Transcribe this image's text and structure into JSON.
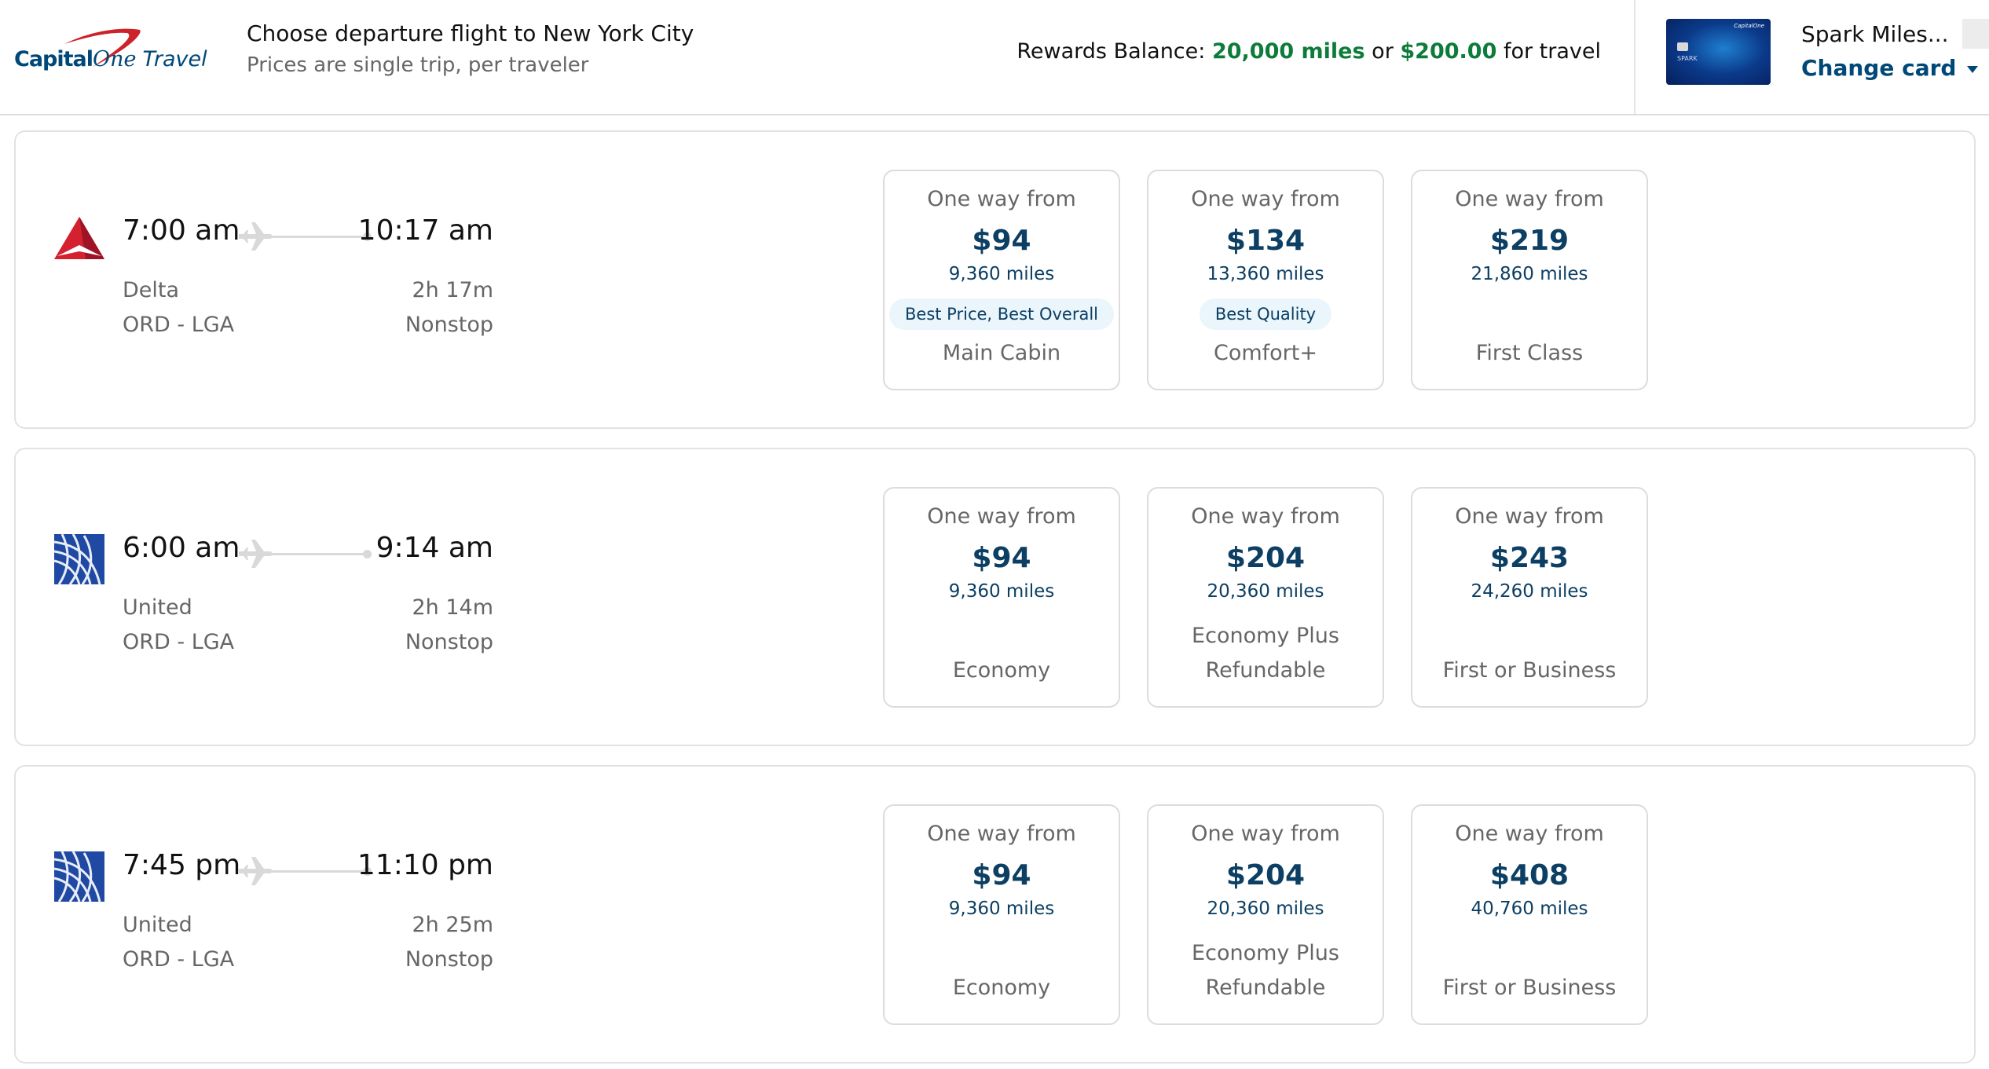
{
  "header": {
    "brand": {
      "name_bold": "Capital",
      "name_script": "One",
      "name_suffix": "Travel"
    },
    "title": "Choose departure flight to New York City",
    "subtitle": "Prices are single trip, per traveler",
    "rewards": {
      "label": "Rewards Balance:",
      "miles": "20,000 miles",
      "connector": "or",
      "cash": "$200.00",
      "suffix": "for travel"
    },
    "card": {
      "name": "Spark Miles...",
      "image_label": "SPARK",
      "change_label": "Change card"
    }
  },
  "flights": [
    {
      "airline": "Delta",
      "logo": "delta-logo-icon",
      "departure": "7:00 am",
      "arrival": "10:17 am",
      "route": "ORD - LGA",
      "duration": "2h 17m",
      "stops": "Nonstop",
      "fares": [
        {
          "from": "One way from",
          "price": "$94",
          "miles": "9,360 miles",
          "badge": "Best Price, Best Overall",
          "cabin": "Main Cabin"
        },
        {
          "from": "One way from",
          "price": "$134",
          "miles": "13,360 miles",
          "badge": "Best Quality",
          "cabin": "Comfort+"
        },
        {
          "from": "One way from",
          "price": "$219",
          "miles": "21,860 miles",
          "cabin": "First Class"
        }
      ]
    },
    {
      "airline": "United",
      "logo": "united-logo-icon",
      "departure": "6:00 am",
      "arrival": "9:14 am",
      "route": "ORD - LGA",
      "duration": "2h 14m",
      "stops": "Nonstop",
      "fares": [
        {
          "from": "One way from",
          "price": "$94",
          "miles": "9,360 miles",
          "cabin": "Economy"
        },
        {
          "from": "One way from",
          "price": "$204",
          "miles": "20,360 miles",
          "cabin_line1": "Economy Plus",
          "cabin": "Refundable"
        },
        {
          "from": "One way from",
          "price": "$243",
          "miles": "24,260 miles",
          "cabin": "First or Business"
        }
      ]
    },
    {
      "airline": "United",
      "logo": "united-logo-icon",
      "departure": "7:45 pm",
      "arrival": "11:10 pm",
      "route": "ORD - LGA",
      "duration": "2h 25m",
      "stops": "Nonstop",
      "fares": [
        {
          "from": "One way from",
          "price": "$94",
          "miles": "9,360 miles",
          "cabin": "Economy"
        },
        {
          "from": "One way from",
          "price": "$204",
          "miles": "20,360 miles",
          "cabin_line1": "Economy Plus",
          "cabin": "Refundable"
        },
        {
          "from": "One way from",
          "price": "$408",
          "miles": "40,760 miles",
          "cabin": "First or Business"
        }
      ]
    }
  ],
  "colors": {
    "brand_navy": "#004878",
    "price_navy": "#0c3f63",
    "rewards_green": "#0d7c3a",
    "badge_bg": "#eaf5fc",
    "delta_red": "#c8102e",
    "united_blue": "#1f49a3"
  }
}
